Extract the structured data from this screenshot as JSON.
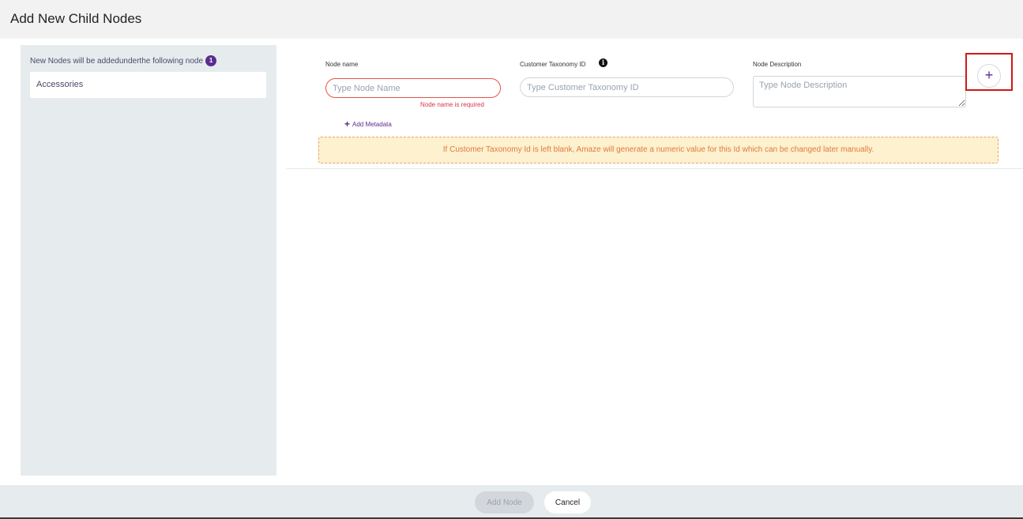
{
  "header": {
    "title": "Add New Child Nodes"
  },
  "left_panel": {
    "caption": "New Nodes will be addedunderthe following node",
    "badge_count": "1",
    "parent_node": "Accessories"
  },
  "form": {
    "node_name": {
      "label": "Node name",
      "placeholder": "Type Node Name",
      "error": "Node name is required"
    },
    "taxonomy_id": {
      "label": "Customer Taxonomy ID",
      "placeholder": "Type Customer Taxonomy ID",
      "info_icon": "info-icon"
    },
    "description": {
      "label": "Node Description",
      "placeholder": "Type Node Description"
    },
    "add_metadata": "Add Metadata",
    "add_row_symbol": "+"
  },
  "notice": "If Customer Taxonomy Id is left blank, Amaze will generate a numeric value for this Id which can be changed later manually.",
  "footer": {
    "add_node_label": "Add Node",
    "cancel_label": "Cancel"
  },
  "colors": {
    "accent": "#5b2d8e",
    "error": "#e0554c",
    "highlight": "#d01818",
    "notice_bg": "#fdf1cf",
    "notice_text": "#e07a3b"
  }
}
